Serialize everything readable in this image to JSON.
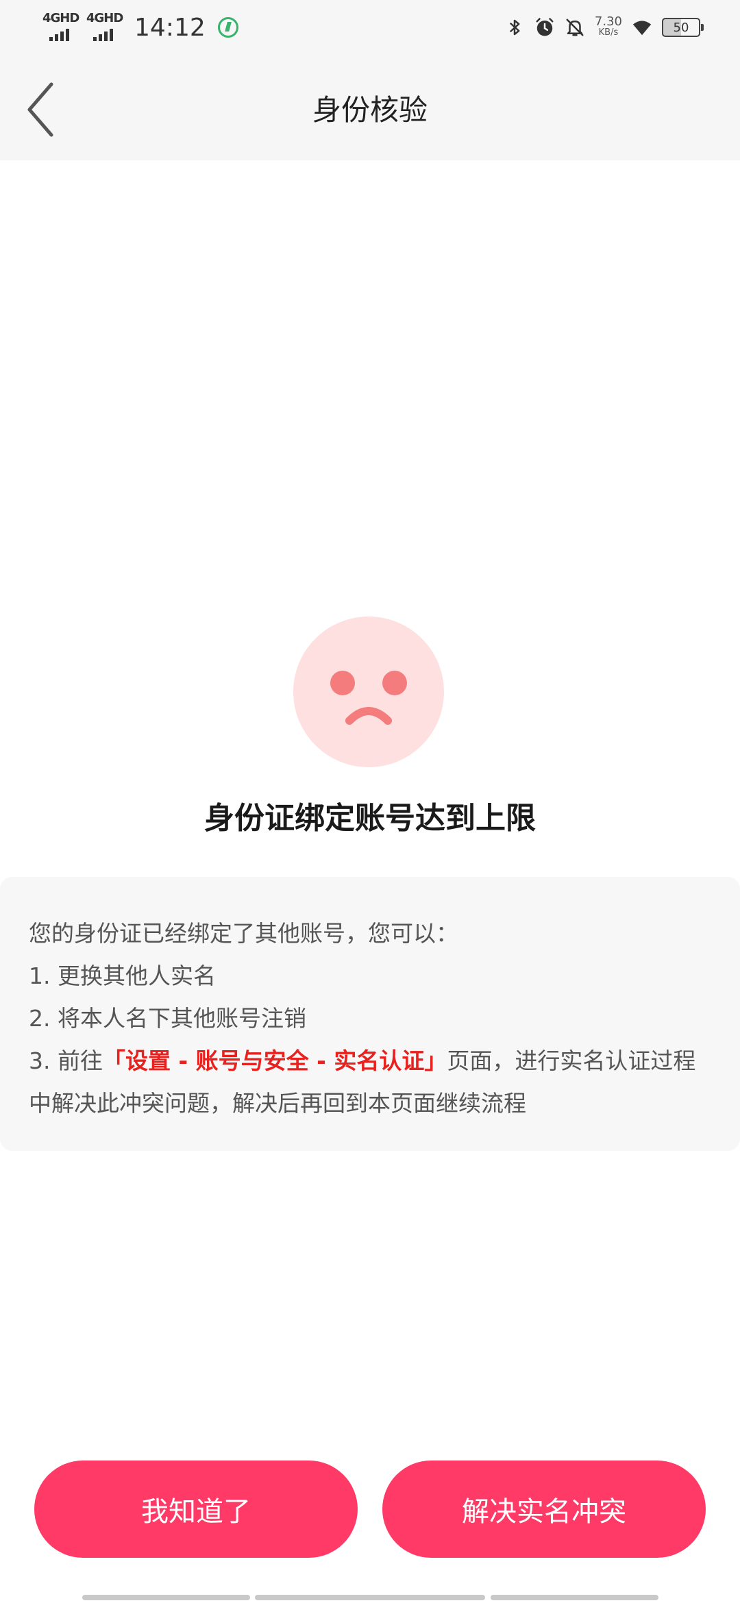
{
  "status_bar": {
    "network_1": "4GHD",
    "network_2": "4GHD",
    "time": "14:12",
    "speed_value": "7.30",
    "speed_unit": "KB/s",
    "battery": "50"
  },
  "header": {
    "title": "身份核验"
  },
  "main": {
    "title": "身份证绑定账号达到上限"
  },
  "info": {
    "intro": "您的身份证已经绑定了其他账号，您可以：",
    "option1": "1. 更换其他人实名",
    "option2": "2. 将本人名下其他账号注销",
    "option3_prefix": "3. 前往",
    "option3_highlight": "「设置 - 账号与安全 - 实名认证」",
    "option3_suffix": "页面，进行实名认证过程中解决此冲突问题，解决后再回到本页面继续流程"
  },
  "buttons": {
    "ok_label": "我知道了",
    "resolve_label": "解决实名冲突"
  },
  "colors": {
    "accent": "#ff3a67",
    "highlight": "#e8211e",
    "face_bg": "#ffe0e0",
    "face_feature": "#f47c7c"
  },
  "icons": {
    "back": "chevron-left-icon",
    "sad_face": "sad-face-icon",
    "bluetooth": "bluetooth-icon",
    "alarm": "alarm-icon",
    "mute": "bell-off-icon",
    "wifi": "wifi-icon"
  }
}
